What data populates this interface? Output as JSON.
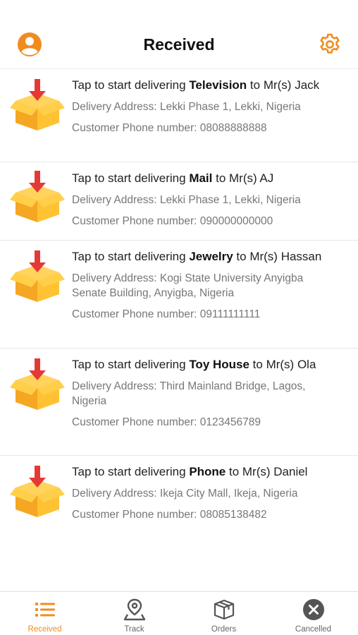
{
  "header": {
    "title": "Received",
    "profile_icon": "user-circle-icon",
    "settings_icon": "gear-icon"
  },
  "colors": {
    "accent": "#f08c1f",
    "box": "#ffc233",
    "arrow": "#e53935"
  },
  "deliveries": [
    {
      "prefix": "Tap to start delivering ",
      "item": "Television",
      "suffix": " to Mr(s) Jack",
      "address": "Delivery Address: Lekki Phase 1, Lekki, Nigeria",
      "phone": "Customer Phone number: 08088888888"
    },
    {
      "prefix": "Tap to start delivering ",
      "item": "Mail",
      "suffix": " to Mr(s) AJ",
      "address": "Delivery Address: Lekki Phase 1, Lekki, Nigeria",
      "phone": "Customer Phone number: 090000000000"
    },
    {
      "prefix": "Tap to start delivering ",
      "item": "Jewelry",
      "suffix": "  to Mr(s) Hassan",
      "address": "Delivery Address: Kogi State University Anyigba Senate Building, Anyigba, Nigeria",
      "phone": "Customer Phone number: 09111111111"
    },
    {
      "prefix": "Tap to start delivering ",
      "item": "Toy House",
      "suffix": " to Mr(s) Ola",
      "address": "Delivery Address: Third Mainland Bridge, Lagos, Nigeria",
      "phone": "Customer Phone number: 0123456789"
    },
    {
      "prefix": "Tap to start delivering ",
      "item": "Phone",
      "suffix": " to Mr(s) Daniel",
      "address": "Delivery Address: Ikeja City Mall, Ikeja, Nigeria",
      "phone": "Customer Phone number: 08085138482"
    }
  ],
  "nav": {
    "tabs": [
      {
        "label": "Received",
        "icon": "list-icon",
        "active": true
      },
      {
        "label": "Track",
        "icon": "map-pin-icon",
        "active": false
      },
      {
        "label": "Orders",
        "icon": "package-icon",
        "active": false
      },
      {
        "label": "Cancelled",
        "icon": "cancel-circle-icon",
        "active": false
      }
    ]
  }
}
